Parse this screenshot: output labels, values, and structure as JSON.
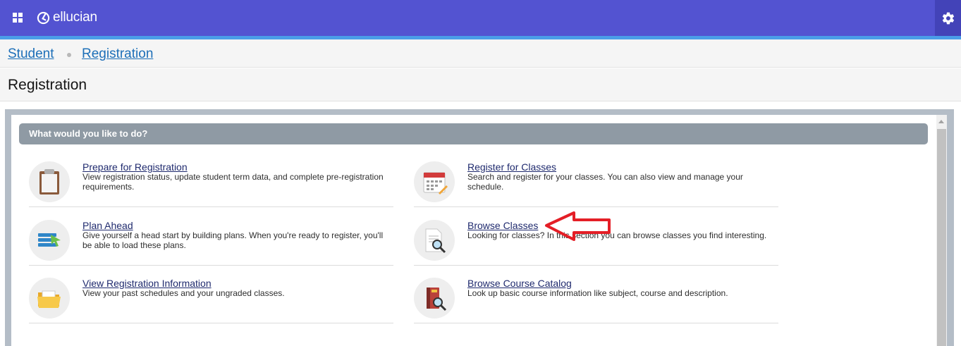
{
  "header": {
    "brand": "ellucian",
    "icons": [
      "grid-icon",
      "ellucian-logo-icon",
      "gear-icon"
    ],
    "colors": {
      "bar": "#5353d1",
      "accent_line": "#4a9de8",
      "gear_bg": "#4343b8"
    }
  },
  "breadcrumb": {
    "items": [
      {
        "label": "Student"
      },
      {
        "label": "Registration"
      }
    ]
  },
  "page": {
    "title": "Registration"
  },
  "panel": {
    "header": "What would you like to do?",
    "items": [
      {
        "title": "Prepare for Registration",
        "desc": "View registration status, update student term data, and complete pre-registration requirements.",
        "icon": "clipboard-icon"
      },
      {
        "title": "Register for Classes",
        "desc": "Search and register for your classes. You can also view and manage your schedule.",
        "icon": "calendar-icon"
      },
      {
        "title": "Plan Ahead",
        "desc": "Give yourself a head start by building plans. When you're ready to register, you'll be able to load these plans.",
        "icon": "plan-list-icon"
      },
      {
        "title": "Browse Classes",
        "desc": "Looking for classes? In this section you can browse classes you find interesting.",
        "icon": "document-search-icon"
      },
      {
        "title": "View Registration Information",
        "desc": "View your past schedules and your ungraded classes.",
        "icon": "folder-icon"
      },
      {
        "title": "Browse Course Catalog",
        "desc": "Look up basic course information like subject, course and description.",
        "icon": "book-search-icon"
      }
    ]
  },
  "annotation": {
    "arrow_color": "#e41e26",
    "icon": "red-arrow-icon"
  }
}
